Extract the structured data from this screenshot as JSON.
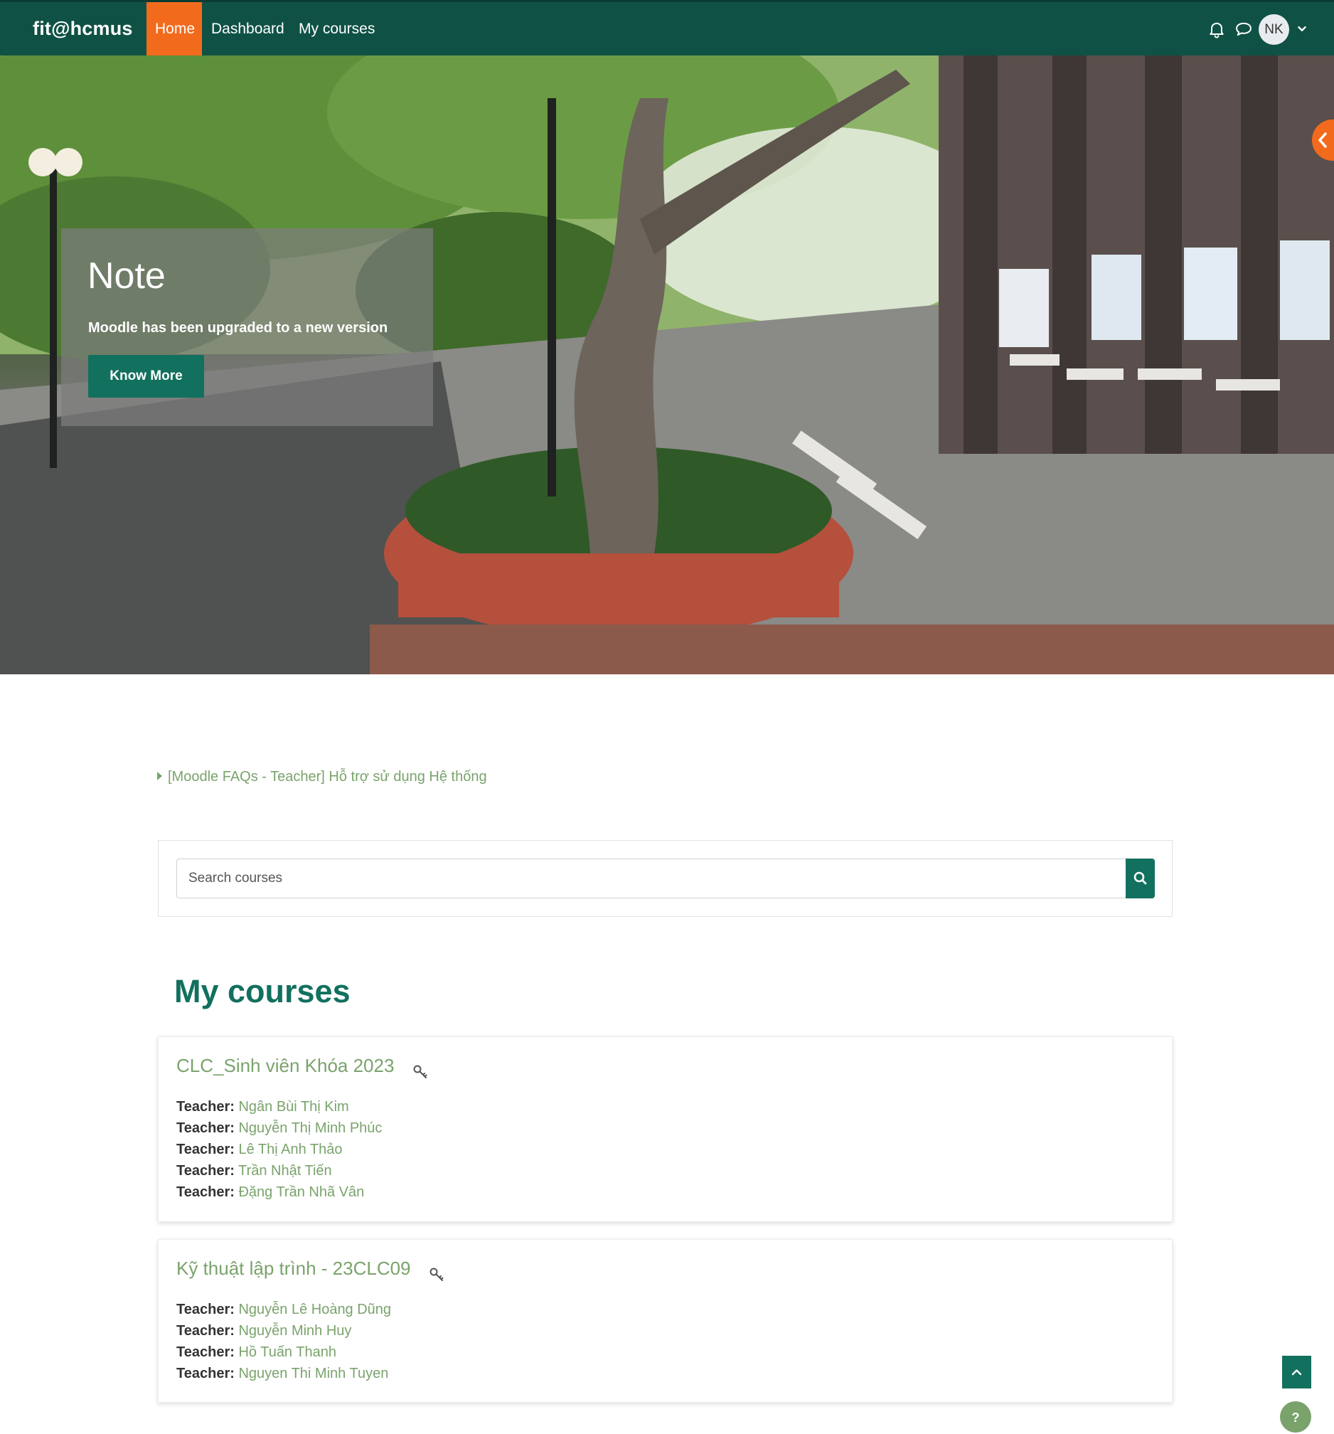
{
  "navbar": {
    "brand": "fit@hcmus",
    "items": [
      "Home",
      "Dashboard",
      "My courses"
    ],
    "active_item": "Home",
    "notification_icon": "bell-icon",
    "message_icon": "chat-bubble-icon",
    "user_initials": "NK",
    "user_menu_icon": "chevron-down-icon",
    "colors": {
      "background": "#0f5245",
      "active": "#f26b1d"
    }
  },
  "hero": {
    "title": "Note",
    "subtitle": "Moodle has been upgraded to a new version",
    "button_label": "Know More",
    "drawer_toggle_icon": "chevron-left-icon"
  },
  "faq_link": "[Moodle FAQs - Teacher] Hỗ trợ sử dụng Hệ thống",
  "search": {
    "placeholder": "Search courses",
    "button_icon": "search-icon"
  },
  "my_courses": {
    "title": "My courses",
    "teacher_label": "Teacher:",
    "courses": [
      {
        "name": "CLC_Sinh viên Khóa 2023",
        "icon": "key-icon",
        "teachers": [
          "Ngân Bùi Thị Kim",
          "Nguyễn Thị Minh Phúc",
          "Lê Thị Anh Thảo",
          "Trần Nhật Tiến",
          "Đặng Trần Nhã Vân"
        ]
      },
      {
        "name": "Kỹ thuật lập trình - 23CLC09",
        "icon": "key-icon",
        "teachers": [
          "Nguyễn Lê Hoàng Dũng",
          "Nguyễn Minh Huy",
          "Hồ Tuấn Thanh",
          "Nguyen Thi Minh Tuyen"
        ]
      }
    ]
  },
  "floating": {
    "back_to_top_icon": "chevron-up-icon",
    "help_label": "?"
  },
  "colors": {
    "accent": "#12705e",
    "link": "#7aa36c"
  }
}
